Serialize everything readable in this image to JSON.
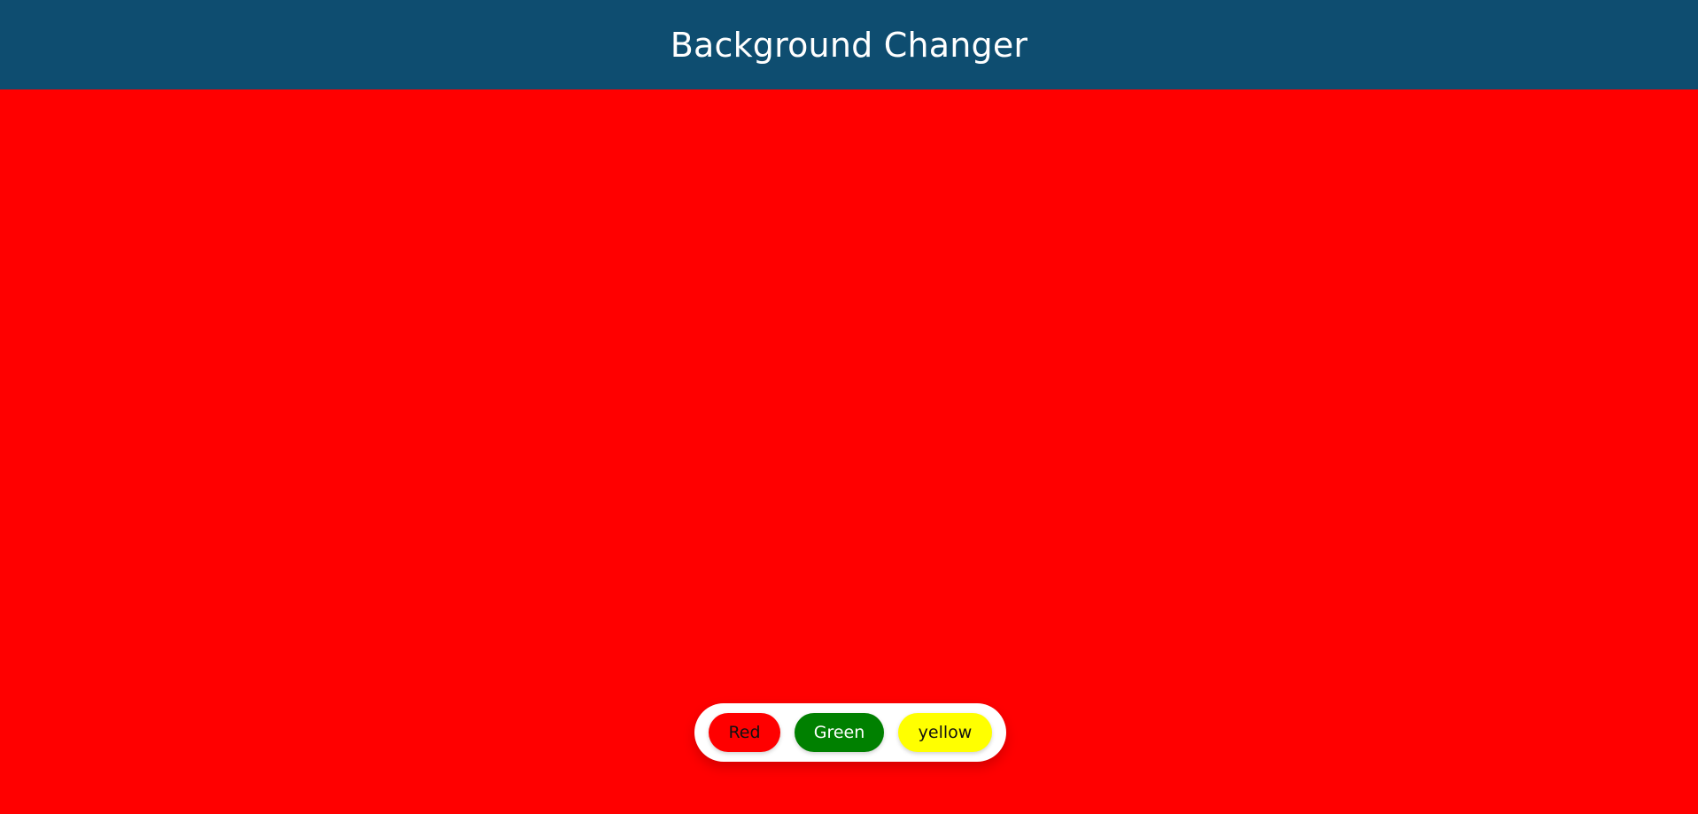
{
  "header": {
    "title": "Background Changer"
  },
  "canvas": {
    "current_background": "#ff0000"
  },
  "toolbar": {
    "buttons": [
      {
        "label": "Red",
        "color": "#ff0000",
        "text_color": "#111111"
      },
      {
        "label": "Green",
        "color": "#008000",
        "text_color": "#ffffff"
      },
      {
        "label": "yellow",
        "color": "#ffff00",
        "text_color": "#111111"
      }
    ]
  },
  "colors": {
    "header_bg": "#0e4d70",
    "toolbar_bg": "#ffffff"
  }
}
